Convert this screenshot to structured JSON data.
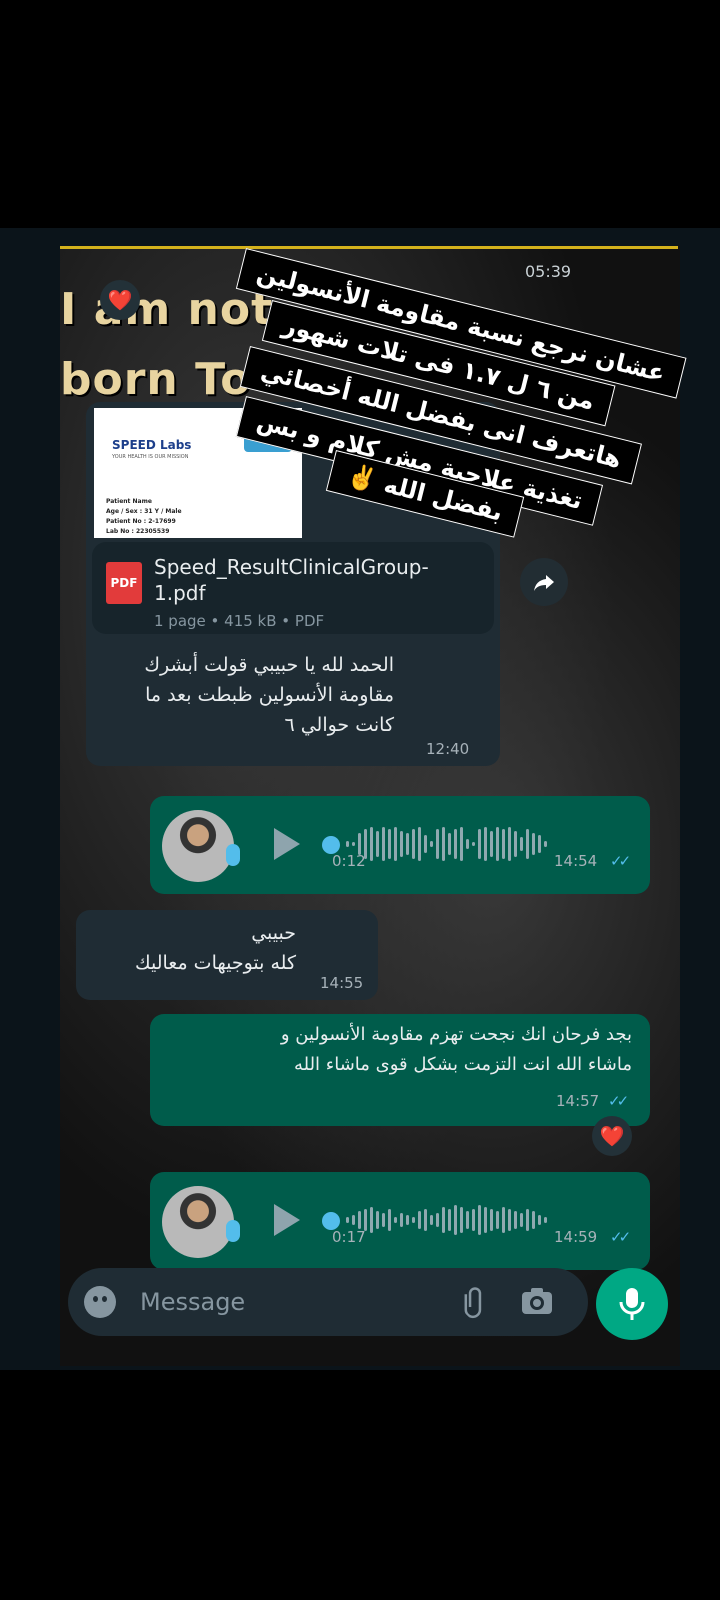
{
  "status": {
    "time": "05:39"
  },
  "background": {
    "line1": "I am not",
    "line2": "born To die",
    "react_heart": "❤️"
  },
  "story_overlay": {
    "lines": [
      "عشان نرجع نسبة مقاومة الأنسولين",
      "من ٦ ل ١.٧ فى تلات شهور",
      "هاتعرف انى بفضل الله أخصائي",
      "تغذية علاجية مش كلام و بس",
      "بفضل الله ✌️"
    ]
  },
  "messages": {
    "doc": {
      "brand": "SPEED Labs",
      "brand_tagline": "YOUR HEALTH IS OUR MISSION",
      "preview_rows": [
        "Patient Name",
        "Age / Sex : 31 Y / Male",
        "Patient No : 2-17699",
        "Lab No : 22305539"
      ],
      "filename": "Speed_ResultClinicalGroup-1.pdf",
      "file_type_label": "PDF",
      "meta": "1 page • 415 kB • PDF",
      "text": "الحمد لله يا حبيبي قولت أبشرك مقاومة الأنسولين ظبطت بعد ما كانت حوالي ٦",
      "time": "12:40"
    },
    "voice1": {
      "duration": "0:12",
      "time": "14:54"
    },
    "in2": {
      "line1": "حبيبي",
      "line2": "كله بتوجيهات معاليك",
      "time": "14:55"
    },
    "out2": {
      "line1": "بجد فرحان انك نجحت تهزم مقاومة الأنسولين و",
      "line2": "ماشاء الله انت التزمت بشكل قوى ماشاء الله",
      "time": "14:57",
      "reaction": "❤️"
    },
    "voice2": {
      "duration": "0:17",
      "time": "14:59"
    }
  },
  "composer": {
    "placeholder": "Message"
  }
}
